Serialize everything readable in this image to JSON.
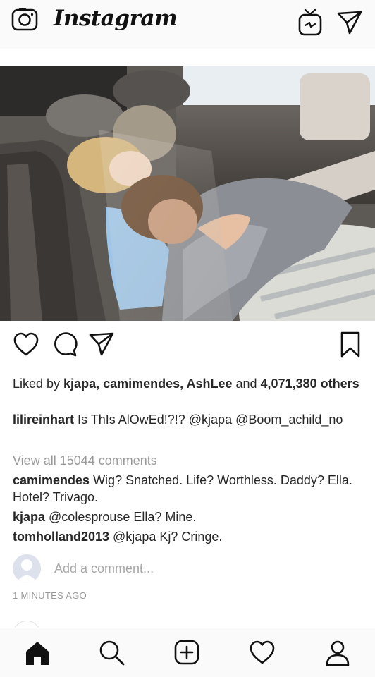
{
  "header": {
    "logo_text": "Instagram",
    "icons": [
      "camera-icon",
      "igtv-icon",
      "direct-message-icon"
    ]
  },
  "post": {
    "photo_alt": "two people asleep in the back seat of a car",
    "action_icons": [
      "heart-icon",
      "comment-icon",
      "share-icon",
      "bookmark-icon"
    ],
    "likes": {
      "prefix": "Liked by ",
      "users": "kjapa, camimendes, AshLee",
      "and": " and ",
      "count": "4,071,380 others"
    },
    "caption": {
      "user": "lilireinhart",
      "text": " Is ThIs AlOwEd!?!? @kjapa @Boom_achild_no"
    },
    "view_all": "View all 15044 comments",
    "comments": [
      {
        "user": "camimendes",
        "text": " Wig? Snatched. Life? Worthless. Daddy? Ella. Hotel? Trivago."
      },
      {
        "user": "kjapa",
        "text": " @colesprouse Ella? Mine."
      },
      {
        "user": "tomholland2013",
        "text": " @kjapa Kj? Cringe."
      }
    ],
    "add_comment_placeholder": "Add a comment...",
    "timestamp": "1 MINUTES AGO"
  },
  "bottom_nav": {
    "tabs": [
      "home-icon",
      "search-icon",
      "new-post-icon",
      "activity-icon",
      "profile-icon"
    ],
    "active": "home-icon"
  },
  "colors": {
    "text": "#262626",
    "muted": "#999999",
    "bar_bg": "#fafafa",
    "border": "#dbdbdb"
  }
}
